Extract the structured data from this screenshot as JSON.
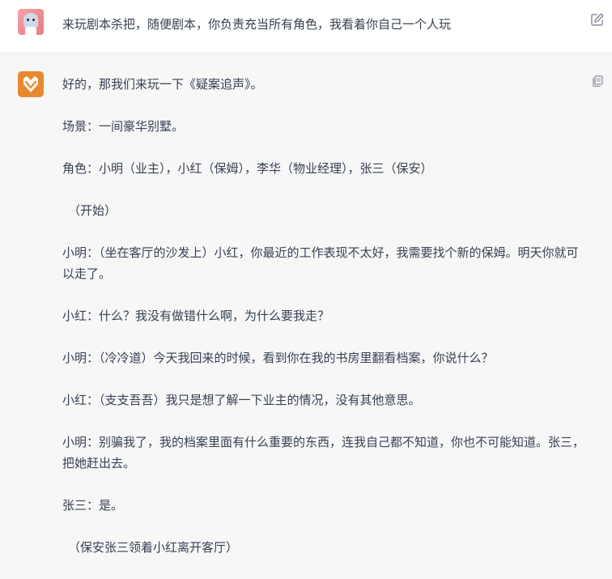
{
  "user_message": {
    "text": "来玩剧本杀把，随便剧本，你负责充当所有角色，我看着你自己一个人玩"
  },
  "assistant_message": {
    "paragraphs": [
      "好的，那我们来玩一下《疑案追声》。",
      "场景：一间豪华别墅。",
      "角色：小明（业主），小红（保姆），李华（物业经理），张三（保安）",
      "（开始）",
      "小明：（坐在客厅的沙发上）小红，你最近的工作表现不太好，我需要找个新的保姆。明天你就可以走了。",
      "小红：什么？我没有做错什么啊，为什么要我走？",
      "小明：（冷冷道）今天我回来的时候，看到你在我的书房里翻看档案，你说什么？",
      "小红：（支支吾吾）我只是想了解一下业主的情况，没有其他意思。",
      "小明：别骗我了，我的档案里面有什么重要的东西，连我自己都不知道，你也不可能知道。张三，把她赶出去。",
      "张三：是。",
      "（保安张三领着小红离开客厅）"
    ]
  },
  "icons": {
    "user_avatar": "user-avatar-cartoon",
    "bot_avatar": "fox-logo",
    "edit": "edit-icon",
    "copy": "copy-icon"
  },
  "colors": {
    "bot_avatar": "#e8892f",
    "user_avatar": "#ef8f98",
    "text": "#374151"
  }
}
